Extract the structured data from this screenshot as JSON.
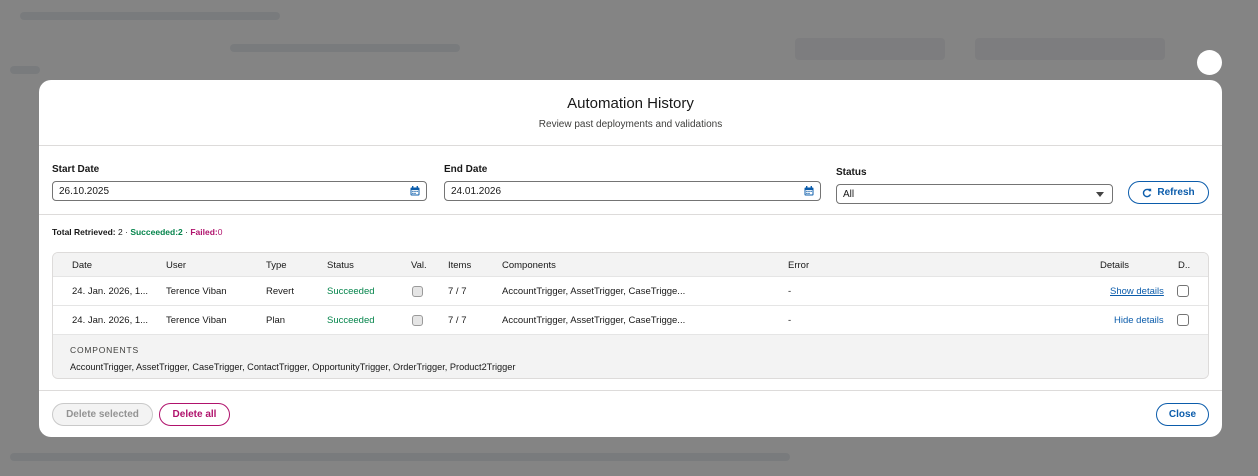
{
  "modal": {
    "title": "Automation History",
    "subtitle": "Review past deployments and validations"
  },
  "filters": {
    "start_date_label": "Start Date",
    "start_date_value": "26.10.2025",
    "end_date_label": "End Date",
    "end_date_value": "24.01.2026",
    "status_label": "Status",
    "status_value": "All",
    "refresh_label": "Refresh"
  },
  "summary": {
    "total_label": "Total Retrieved:",
    "total_value": "2",
    "sep": "·",
    "succeeded_label": "Succeeded:",
    "succeeded_value": "2",
    "failed_label": "Failed:",
    "failed_value": "0"
  },
  "table": {
    "headers": {
      "date": "Date",
      "user": "User",
      "type": "Type",
      "status": "Status",
      "val": "Val.",
      "items": "Items",
      "components": "Components",
      "error": "Error",
      "details": "Details",
      "d": "D.."
    },
    "rows": [
      {
        "date": "24. Jan. 2026, 1...",
        "user": "Terence Viban",
        "type": "Revert",
        "status": "Succeeded",
        "items": "7 / 7",
        "components": "AccountTrigger, AssetTrigger, CaseTrigge...",
        "error": "-",
        "details": "Show details"
      },
      {
        "date": "24. Jan. 2026, 1...",
        "user": "Terence Viban",
        "type": "Plan",
        "status": "Succeeded",
        "items": "7 / 7",
        "components": "AccountTrigger, AssetTrigger, CaseTrigge...",
        "error": "-",
        "details": "Hide details"
      }
    ],
    "detail_panel": {
      "heading": "COMPONENTS",
      "body": "AccountTrigger, AssetTrigger, CaseTrigger, ContactTrigger, OpportunityTrigger, OrderTrigger, Product2Trigger"
    }
  },
  "footer": {
    "delete_selected_label": "Delete selected",
    "delete_all_label": "Delete all",
    "close_label": "Close"
  },
  "icons": {
    "calendar": "calendar-icon",
    "dropdown": "chevron-down-icon",
    "refresh": "refresh-icon"
  },
  "colors": {
    "brand": "#0b5cab",
    "success": "#04844b",
    "danger": "#b0126c"
  }
}
